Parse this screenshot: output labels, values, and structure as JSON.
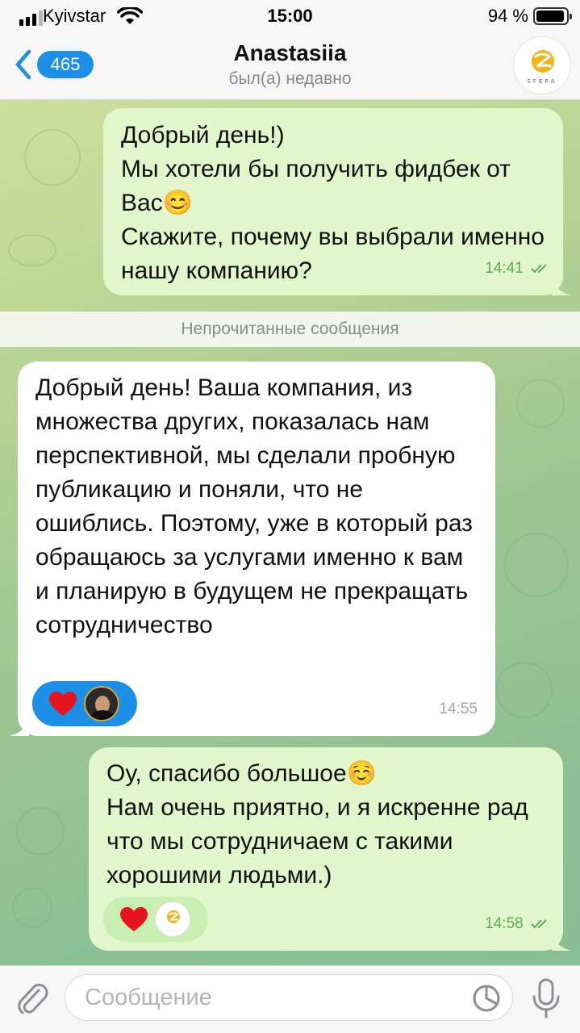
{
  "status_bar": {
    "carrier": "Kyivstar",
    "time": "15:00",
    "battery_percent": "94 %",
    "battery_level": 0.94
  },
  "header": {
    "back_count": "465",
    "contact_name": "Anastasiia",
    "status": "был(а) недавно",
    "avatar_logo_text": "SFERA",
    "back_icon": "chevron-left-icon"
  },
  "messages": [
    {
      "direction": "outgoing",
      "text": "Добрый день!)\nМы хотели бы получить фидбек от Вас😊\nСкажите, почему вы выбрали именно нашу компанию?",
      "time": "14:41",
      "read": true
    },
    {
      "direction": "incoming",
      "text": "Добрый день! Ваша компания, из множества других, показалась нам перспективной, мы сделали пробную публикацию и поняли, что не ошиблись. Поэтому, уже в который раз обращаюсь за услугами именно к вам и планирую в  будущем не прекращать сотрудничество",
      "time": "14:55",
      "reaction": "heart",
      "reaction_color": "#1c8fe6"
    },
    {
      "direction": "outgoing",
      "text": "Оу, спасибо большое☺️\nНам очень приятно, и я искренне рад что мы сотрудничаем с такими хорошими людьми.)",
      "time": "14:58",
      "read": true,
      "reaction": "heart",
      "reaction_color": "#c9eeb1"
    }
  ],
  "unread_divider": "Непрочитанные сообщения",
  "composer": {
    "placeholder": "Сообщение",
    "value": "",
    "icons": [
      "paperclip-icon",
      "sticker-icon",
      "microphone-icon"
    ]
  },
  "colors": {
    "accent": "#1c8fe6",
    "outgoing_bubble": "#e1f7cb",
    "incoming_bubble": "#ffffff",
    "heart": "#e5141f"
  }
}
